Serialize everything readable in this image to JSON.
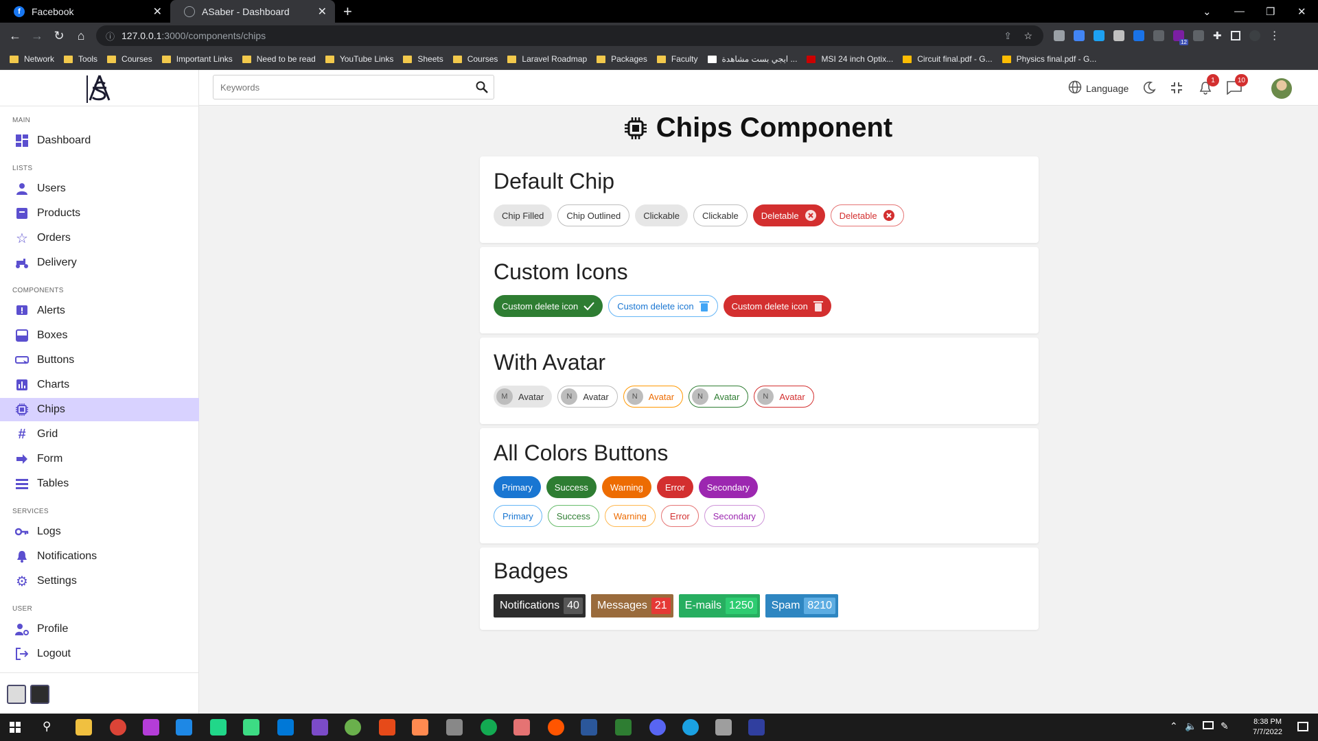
{
  "browser": {
    "tabs": [
      {
        "title": "Facebook"
      },
      {
        "title": "ASaber - Dashboard"
      }
    ],
    "url_host": "127.0.0.1",
    "url_path": ":3000/components/chips",
    "bookmarks": [
      "Network",
      "Tools",
      "Courses",
      "Important Links",
      "Need to be read",
      "YouTube Links",
      "Sheets",
      "Courses",
      "Laravel Roadmap",
      "Packages",
      "Faculty",
      "ايجي بست مشاهدة ...",
      "MSI 24 inch Optix...",
      "Circuit final.pdf - G...",
      "Physics final.pdf - G..."
    ],
    "ext_badge": "12"
  },
  "sidebar": {
    "groups": {
      "main": "MAIN",
      "lists": "LISTS",
      "components": "COMPONENTS",
      "services": "SERVICES",
      "user": "USER"
    },
    "items": {
      "dashboard": "Dashboard",
      "users": "Users",
      "products": "Products",
      "orders": "Orders",
      "delivery": "Delivery",
      "alerts": "Alerts",
      "boxes": "Boxes",
      "buttons": "Buttons",
      "charts": "Charts",
      "chips": "Chips",
      "grid": "Grid",
      "form": "Form",
      "tables": "Tables",
      "logs": "Logs",
      "notifications": "Notifications",
      "settings": "Settings",
      "profile": "Profile",
      "logout": "Logout"
    }
  },
  "topbar": {
    "search_placeholder": "Keywords",
    "language": "Language",
    "notif_count": "1",
    "msg_count": "10"
  },
  "page": {
    "title": "Chips Component",
    "default": {
      "title": "Default Chip",
      "chips": [
        "Chip Filled",
        "Chip Outlined",
        "Clickable",
        "Clickable",
        "Deletable",
        "Deletable"
      ]
    },
    "custom": {
      "title": "Custom Icons",
      "chips": [
        "Custom delete icon",
        "Custom delete icon",
        "Custom delete icon"
      ]
    },
    "avatar": {
      "title": "With Avatar",
      "chips": [
        {
          "letter": "M",
          "label": "Avatar"
        },
        {
          "letter": "N",
          "label": "Avatar"
        },
        {
          "letter": "N",
          "label": "Avatar"
        },
        {
          "letter": "N",
          "label": "Avatar"
        },
        {
          "letter": "N",
          "label": "Avatar"
        }
      ]
    },
    "colors": {
      "title": "All Colors Buttons",
      "labels": [
        "Primary",
        "Success",
        "Warning",
        "Error",
        "Secondary"
      ]
    },
    "badges": {
      "title": "Badges",
      "items": [
        {
          "label": "Notifications",
          "count": "40"
        },
        {
          "label": "Messages",
          "count": "21"
        },
        {
          "label": "E-mails",
          "count": "1250"
        },
        {
          "label": "Spam",
          "count": "8210"
        }
      ]
    }
  },
  "colors": {
    "primary": "#1976d2",
    "success": "#2e7d32",
    "warning": "#ed6c02",
    "error": "#d32f2f",
    "secondary": "#9c27b0",
    "accent": "#5b4fcf"
  },
  "taskbar": {
    "time": "8:38 PM",
    "date": "7/7/2022"
  }
}
